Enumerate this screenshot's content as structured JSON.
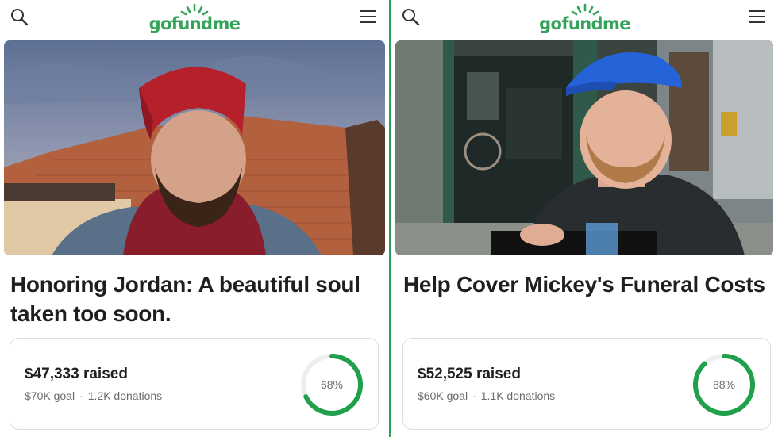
{
  "brand": {
    "logo_text": "gofundme",
    "accent": "#35a35a",
    "ring_color": "#20a04a",
    "divider": "#2e9e5b"
  },
  "icons": {
    "search": "search-icon",
    "menu": "hamburger-menu-icon",
    "logo_sun": "sunburst-logo-icon"
  },
  "campaigns": [
    {
      "title": "Honoring Jordan: A beautiful soul taken too soon.",
      "raised": "$47,333 raised",
      "goal": "$70K goal",
      "separator": "·",
      "donations": "1.2K donations",
      "progress_label": "68%",
      "progress": 0.68
    },
    {
      "title": "Help Cover Mickey's Funeral Costs",
      "raised": "$52,525 raised",
      "goal": "$60K goal",
      "separator": "·",
      "donations": "1.1K donations",
      "progress_label": "88%",
      "progress": 0.88
    }
  ]
}
